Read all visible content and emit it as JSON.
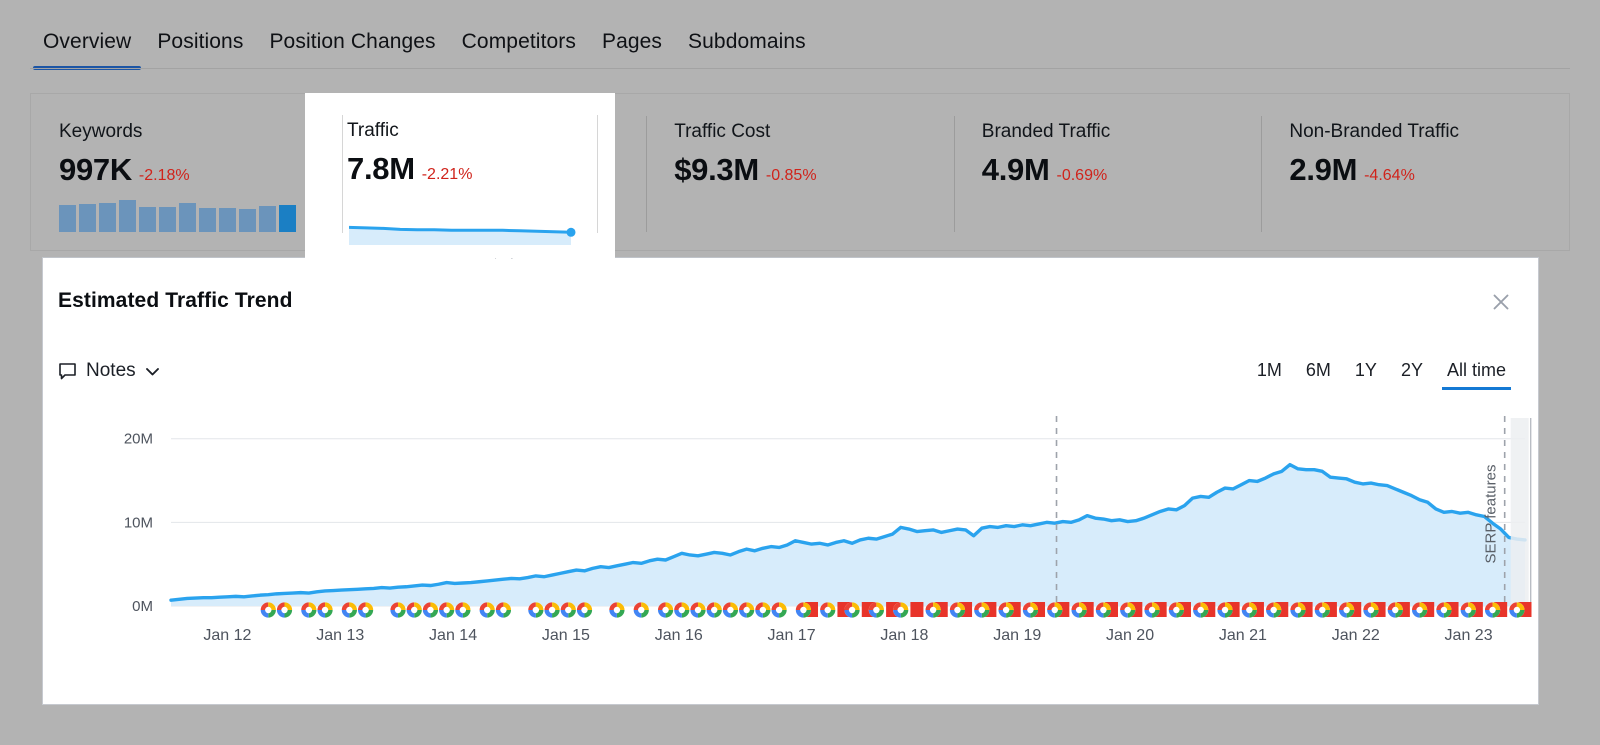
{
  "tabs": [
    {
      "label": "Overview",
      "active": true
    },
    {
      "label": "Positions",
      "active": false
    },
    {
      "label": "Position Changes",
      "active": false
    },
    {
      "label": "Competitors",
      "active": false
    },
    {
      "label": "Pages",
      "active": false
    },
    {
      "label": "Subdomains",
      "active": false
    }
  ],
  "cards": [
    {
      "label": "Keywords",
      "value": "997K",
      "delta": "-2.18%",
      "spark": "bars"
    },
    {
      "label": "Traffic",
      "value": "7.8M",
      "delta": "-2.21%",
      "spark": "area",
      "selected": true
    },
    {
      "label": "Traffic Cost",
      "value": "$9.3M",
      "delta": "-0.85%",
      "spark": "none"
    },
    {
      "label": "Branded Traffic",
      "value": "4.9M",
      "delta": "-0.69%",
      "spark": "none"
    },
    {
      "label": "Non-Branded Traffic",
      "value": "2.9M",
      "delta": "-4.64%",
      "spark": "none"
    }
  ],
  "keywords_sparkline": [
    26,
    27,
    28,
    31,
    24,
    24,
    28,
    23,
    23,
    22,
    25,
    26
  ],
  "traffic_sparkline": [
    8.0,
    7.9,
    7.8,
    7.6,
    7.5,
    7.5,
    7.4,
    7.4,
    7.4,
    7.4,
    7.3,
    7.2,
    7.1,
    7.0
  ],
  "panel": {
    "title": "Estimated Traffic Trend",
    "close_label": "×",
    "notes_label": "Notes",
    "notes_icon": "note-bubble-icon",
    "chevron_icon": "chevron-down-icon"
  },
  "ranges": [
    {
      "label": "1M",
      "active": false
    },
    {
      "label": "6M",
      "active": false
    },
    {
      "label": "1Y",
      "active": false
    },
    {
      "label": "2Y",
      "active": false
    },
    {
      "label": "All time",
      "active": true
    }
  ],
  "colors": {
    "line": "#2aa3ee",
    "area": "#d7ecfb",
    "accent": "#1479d4",
    "delta_negative": "#d0231b",
    "bar": "#6b94bb",
    "bar_last": "#1b7fc4",
    "background": "#b3b3b3",
    "panel": "#ffffff"
  },
  "chart_data": {
    "type": "area",
    "title": "Estimated Traffic Trend",
    "xlabel": "",
    "ylabel": "",
    "ylim": [
      0,
      22
    ],
    "yticks": [
      0,
      10,
      20
    ],
    "ytick_labels": [
      "0M",
      "10M",
      "20M"
    ],
    "grid": true,
    "legend": "none",
    "unit": "M",
    "categories": [
      "Jan 12",
      "Jan 13",
      "Jan 14",
      "Jan 15",
      "Jan 16",
      "Jan 17",
      "Jan 18",
      "Jan 19",
      "Jan 20",
      "Jan 21",
      "Jan 22",
      "Jan 23"
    ],
    "series": [
      {
        "name": "Estimated Traffic",
        "values": [
          0.7,
          0.8,
          0.9,
          0.95,
          1.0,
          1.0,
          1.05,
          1.1,
          1.15,
          1.1,
          1.2,
          1.3,
          1.35,
          1.45,
          1.5,
          1.55,
          1.6,
          1.55,
          1.7,
          1.8,
          1.85,
          1.9,
          1.95,
          2.0,
          2.05,
          2.1,
          2.2,
          2.15,
          2.25,
          2.3,
          2.4,
          2.5,
          2.45,
          2.6,
          2.8,
          2.7,
          2.75,
          2.8,
          2.9,
          3.0,
          3.1,
          3.2,
          3.3,
          3.25,
          3.4,
          3.6,
          3.5,
          3.7,
          3.9,
          4.1,
          4.3,
          4.2,
          4.5,
          4.7,
          4.6,
          4.8,
          5.0,
          5.2,
          5.1,
          5.4,
          5.6,
          5.5,
          5.9,
          6.3,
          6.1,
          6.0,
          6.2,
          6.4,
          6.3,
          6.1,
          6.5,
          6.8,
          6.6,
          6.9,
          7.1,
          7.0,
          7.3,
          7.8,
          7.6,
          7.4,
          7.5,
          7.3,
          7.6,
          7.8,
          7.5,
          7.9,
          8.1,
          8.0,
          8.3,
          8.6,
          9.4,
          9.2,
          8.9,
          9.0,
          9.1,
          8.8,
          9.0,
          9.2,
          9.1,
          8.4,
          9.3,
          9.5,
          9.4,
          9.6,
          9.5,
          9.7,
          9.6,
          9.8,
          10.0,
          9.9,
          10.1,
          10.0,
          10.3,
          10.8,
          10.5,
          10.4,
          10.2,
          10.3,
          10.1,
          10.2,
          10.5,
          10.9,
          11.3,
          11.6,
          11.5,
          12.0,
          12.9,
          13.1,
          13.0,
          13.6,
          14.1,
          14.0,
          14.5,
          15.0,
          14.9,
          15.3,
          15.8,
          16.1,
          16.9,
          16.4,
          16.3,
          16.3,
          16.1,
          15.4,
          15.3,
          15.2,
          14.8,
          14.6,
          14.7,
          14.5,
          14.4,
          14.0,
          13.6,
          13.2,
          12.7,
          12.4,
          11.6,
          11.2,
          11.3,
          11.1,
          11.2,
          10.9,
          10.7,
          9.9,
          9.2,
          8.2,
          8.0,
          7.9
        ]
      }
    ],
    "markers": {
      "google_update_icon": "google-g-icon",
      "serp_feature_icon": "red-flag-icon",
      "description": "Google algorithm update and SERP feature markers along the x-axis baseline"
    },
    "annotations": [
      {
        "label": "",
        "type": "vertical-dashed-line",
        "x_position": 0.654
      },
      {
        "label": "SERP features",
        "type": "vertical-dashed-line",
        "x_position": 0.985
      }
    ]
  }
}
